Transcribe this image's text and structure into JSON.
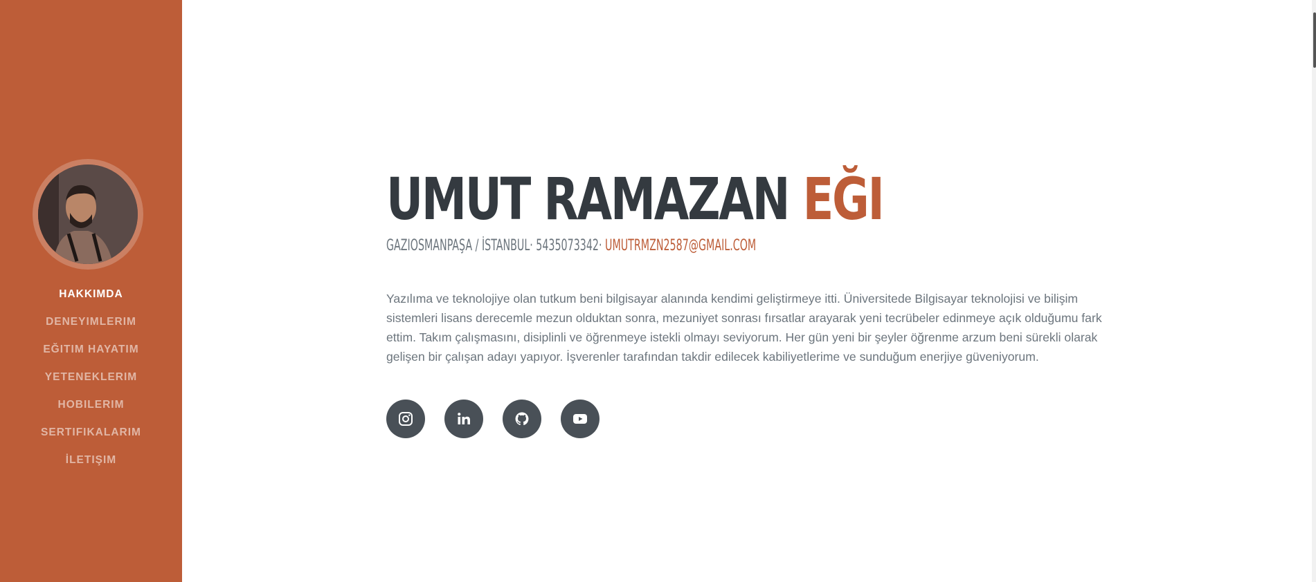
{
  "sidebar": {
    "avatar_alt": "profile photo",
    "nav": [
      {
        "label": "HAKKIMDA",
        "active": true
      },
      {
        "label": "DENEYIMLERIM"
      },
      {
        "label": "EĞITIM HAYATIM"
      },
      {
        "label": "YETENEKLERIM"
      },
      {
        "label": "HOBILERIM"
      },
      {
        "label": "SERTIFIKALARIM"
      },
      {
        "label": "İLETIŞIM"
      }
    ]
  },
  "main": {
    "name_first": "UMUT RAMAZAN",
    "name_last": "EĞI",
    "location_phone": "GAZIOSMANPAŞA / İSTANBUL· 5435073342·",
    "email": "UMUTRMZN2587@GMAIL.COM",
    "bio": "Yazılıma ve teknolojiye olan tutkum beni bilgisayar alanında kendimi geliştirmeye itti. Üniversitede Bilgisayar teknolojisi ve bilişim sistemleri lisans derecemle mezun olduktan sonra, mezuniyet sonrası fırsatlar arayarak yeni tecrübeler edinmeye açık olduğumu fark ettim. Takım çalışmasını, disiplinli ve öğrenmeye istekli olmayı seviyorum. Her gün yeni bir şeyler öğrenme arzum beni sürekli olarak gelişen bir çalışan adayı yapıyor. İşverenler tarafından takdir edilecek kabiliyetlerime ve sunduğum enerjiye güveniyorum.",
    "social": [
      {
        "icon": "instagram-icon"
      },
      {
        "icon": "linkedin-icon"
      },
      {
        "icon": "github-icon"
      },
      {
        "icon": "youtube-icon"
      }
    ]
  },
  "colors": {
    "primary": "#bd5d38",
    "dark": "#343a40",
    "muted": "#6c757d",
    "social_bg": "#495057"
  }
}
